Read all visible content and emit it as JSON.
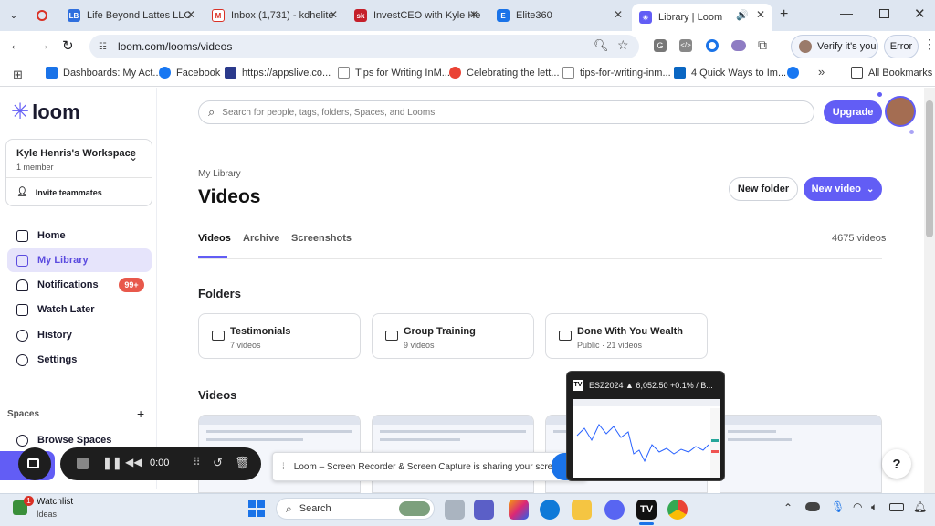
{
  "tabs": [
    {
      "label": "Life Beyond Lattes LLC",
      "fav_color": "#2f6fde",
      "fav_text": "LB"
    },
    {
      "label": "Inbox (1,731) - kdhelite",
      "fav_color": "#d93025",
      "fav_text": "M"
    },
    {
      "label": "InvestCEO with Kyle He",
      "fav_color": "#c51f2a",
      "fav_text": "sk"
    },
    {
      "label": "Elite360",
      "fav_color": "#1a73e8",
      "fav_text": "E"
    },
    {
      "label": "Library | Loom",
      "fav_color": "#625df5",
      "fav_text": "✳"
    }
  ],
  "toolbar": {
    "url": "loom.com/looms/videos",
    "verify": "Verify it's you",
    "error": "Error"
  },
  "bookmarks": [
    {
      "label": "Dashboards: My Act...",
      "color": "#1a73e8"
    },
    {
      "label": "Facebook",
      "color": "#1877f2"
    },
    {
      "label": "https://appslive.co...",
      "color": "#2b3a8c"
    },
    {
      "label": "Tips for Writing InM...",
      "color": "#888888"
    },
    {
      "label": "Celebrating the lett...",
      "color": "#ea4335"
    },
    {
      "label": "tips-for-writing-inm...",
      "color": "#888888"
    },
    {
      "label": "4 Quick Ways to Im...",
      "color": "#0a66c2"
    }
  ],
  "bookmarks_all": "All Bookmarks",
  "loom": {
    "logo": "loom",
    "search_placeholder": "Search for people, tags, folders, Spaces, and Looms",
    "upgrade": "Upgrade",
    "workspace_name": "Kyle Henris's Workspace",
    "workspace_members": "1 member",
    "invite": "Invite teammates",
    "nav": [
      "Home",
      "My Library",
      "Notifications",
      "Watch Later",
      "History",
      "Settings"
    ],
    "notif_badge": "99+",
    "spaces_label": "Spaces",
    "browse_spaces": "Browse Spaces",
    "breadcrumb": "My Library",
    "page_title": "Videos",
    "new_folder": "New folder",
    "new_video": "New video",
    "tabs": [
      "Videos",
      "Archive",
      "Screenshots"
    ],
    "video_count": "4675 videos",
    "folders_heading": "Folders",
    "folders": [
      {
        "name": "Testimonials",
        "sub": "7 videos"
      },
      {
        "name": "Group Training",
        "sub": "9 videos"
      },
      {
        "name": "Done With You Wealth",
        "sub": "Public · 21 videos"
      }
    ],
    "videos_heading": "Videos",
    "help": "?"
  },
  "recorder": {
    "time": "0:00",
    "share_msg": "Loom – Screen Recorder & Screen Capture is sharing your screen."
  },
  "tv_popup": {
    "title": "ESZ2024 ▲ 6,052.50 +0.1% / B..."
  },
  "taskbar": {
    "watchlist": "Watchlist",
    "ideas": "Ideas",
    "watch_badge": "1",
    "search": "Search"
  }
}
